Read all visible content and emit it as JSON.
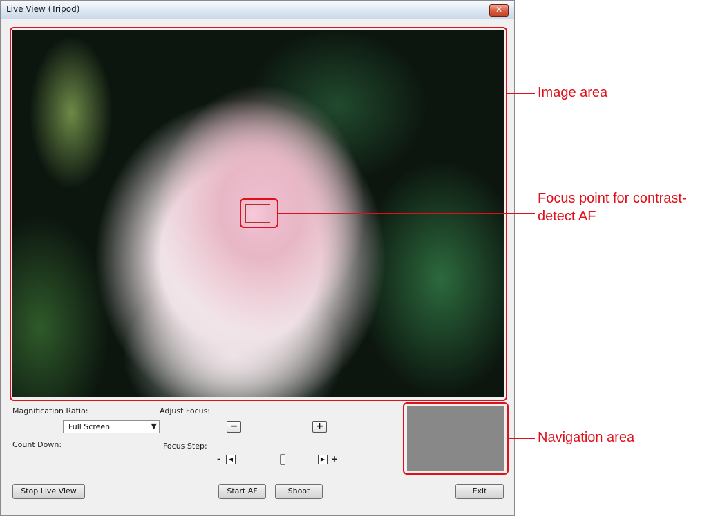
{
  "window": {
    "title": "Live View (Tripod)",
    "close_glyph": "✕"
  },
  "controls": {
    "magnification_label": "Magnification Ratio:",
    "magnification_value": "Full Screen",
    "adjust_focus_label": "Adjust Focus:",
    "adjust_minus_glyph": "−",
    "adjust_plus_glyph": "+",
    "count_down_label": "Count Down:",
    "focus_step_label": "Focus Step:",
    "step_minus": "-",
    "step_plus": "+",
    "step_left_glyph": "◀",
    "step_right_glyph": "▶",
    "focus_step_level": 0.6
  },
  "buttons": {
    "stop_live_view": "Stop Live View",
    "start_af": "Start AF",
    "shoot": "Shoot",
    "exit": "Exit"
  },
  "callouts": {
    "image_area": "Image area",
    "focus_point_line1": "Focus point for contrast-",
    "focus_point_line2": "detect AF",
    "navigation_area": "Navigation area"
  },
  "colors": {
    "callout_red": "#e0101a",
    "nav_area_gray": "#888888"
  }
}
